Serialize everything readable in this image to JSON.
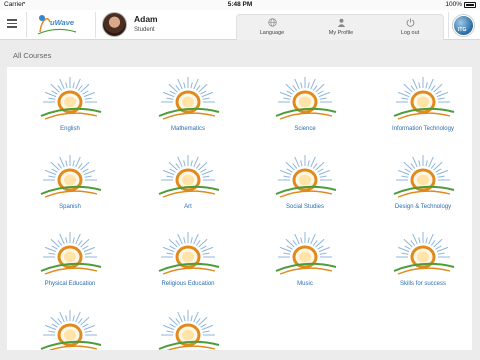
{
  "status_bar": {
    "carrier": "Carrier",
    "time": "5:48 PM",
    "battery": "100%"
  },
  "header": {
    "logo_text": "uWave",
    "user": {
      "name": "Adam",
      "role": "Student"
    },
    "nav": [
      {
        "label": "Language",
        "icon": "globe-icon"
      },
      {
        "label": "My Profile",
        "icon": "person-icon"
      },
      {
        "label": "Log out",
        "icon": "power-icon"
      }
    ],
    "globe_badge": "ITG"
  },
  "page": {
    "section_title": "All Courses"
  },
  "courses": [
    {
      "name": "English"
    },
    {
      "name": "Mathematics"
    },
    {
      "name": "Science"
    },
    {
      "name": "Information Technology"
    },
    {
      "name": "Spanish"
    },
    {
      "name": "Art"
    },
    {
      "name": "Social Studies"
    },
    {
      "name": "Design & Technology"
    },
    {
      "name": "Physical Education"
    },
    {
      "name": "Religious Education"
    },
    {
      "name": "Music"
    },
    {
      "name": "Skills for success"
    },
    {
      "name": ""
    },
    {
      "name": ""
    }
  ],
  "colors": {
    "accent": "#2a6db4",
    "sun": "#e08a1e",
    "ray": "#8fb6dd",
    "ground": "#4b9c3a"
  }
}
